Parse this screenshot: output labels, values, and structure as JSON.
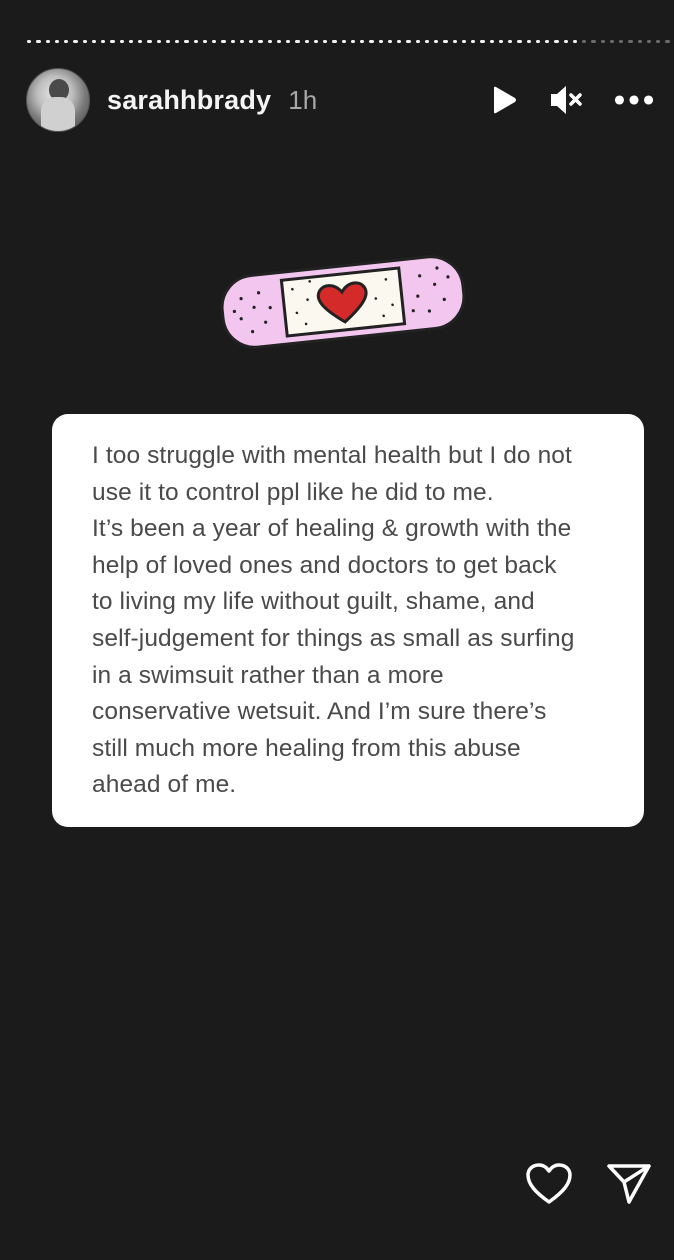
{
  "story": {
    "progress_segments": [
      "done",
      "done",
      "done",
      "done",
      "done",
      "done",
      "done",
      "done",
      "done",
      "done",
      "done",
      "done",
      "done",
      "done",
      "done",
      "done",
      "done",
      "done",
      "done",
      "done",
      "done",
      "done",
      "done",
      "done",
      "done",
      "done",
      "done",
      "done",
      "done",
      "done",
      "done",
      "done",
      "done",
      "done",
      "done",
      "done",
      "done",
      "done",
      "done",
      "done",
      "done",
      "done",
      "done",
      "done",
      "done",
      "done",
      "done",
      "done",
      "done",
      "done",
      "done",
      "done",
      "done",
      "done",
      "done",
      "done",
      "done",
      "done",
      "done",
      "done",
      "rest",
      "rest",
      "rest",
      "rest",
      "rest",
      "rest",
      "rest",
      "rest",
      "rest",
      "rest"
    ],
    "current_segment_index": 59
  },
  "header": {
    "username": "sarahhbrady",
    "time_ago": "1h",
    "icons": {
      "play": "play-icon",
      "mute": "muted-speaker-icon",
      "more": "more-options-icon"
    }
  },
  "sticker": {
    "icon": "heart-bandage-sticker",
    "colors": {
      "pad": "#f2c6ee",
      "heart": "#d42a2a"
    }
  },
  "card": {
    "text": "I too struggle with mental health but I do not\nuse it to control ppl like he did to me.\nIt’s been a year of healing & growth with the\nhelp of loved ones and doctors to get back\nto living my life without guilt, shame, and\nself-judgement for things as small as surfing\nin a swimsuit rather than a more\nconservative wetsuit. And I’m sure there’s\nstill much more healing from this abuse\nahead of me."
  },
  "footer": {
    "icons": {
      "like": "heart-outline-icon",
      "share": "send-icon"
    }
  },
  "colors": {
    "background": "#1b1b1b",
    "card": "#ffffff",
    "card_text": "#4a4a4a",
    "progress_done": "#f2f2f2",
    "progress_rest": "#6b6b6b"
  }
}
